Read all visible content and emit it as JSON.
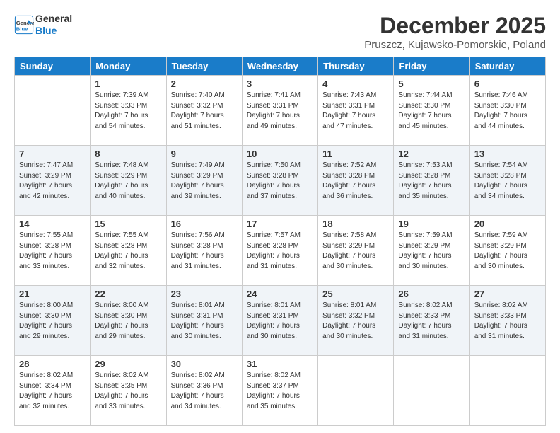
{
  "header": {
    "logo_line1": "General",
    "logo_line2": "Blue",
    "month": "December 2025",
    "location": "Pruszcz, Kujawsko-Pomorskie, Poland"
  },
  "days_of_week": [
    "Sunday",
    "Monday",
    "Tuesday",
    "Wednesday",
    "Thursday",
    "Friday",
    "Saturday"
  ],
  "weeks": [
    [
      {
        "day": "",
        "info": ""
      },
      {
        "day": "1",
        "info": "Sunrise: 7:39 AM\nSunset: 3:33 PM\nDaylight: 7 hours\nand 54 minutes."
      },
      {
        "day": "2",
        "info": "Sunrise: 7:40 AM\nSunset: 3:32 PM\nDaylight: 7 hours\nand 51 minutes."
      },
      {
        "day": "3",
        "info": "Sunrise: 7:41 AM\nSunset: 3:31 PM\nDaylight: 7 hours\nand 49 minutes."
      },
      {
        "day": "4",
        "info": "Sunrise: 7:43 AM\nSunset: 3:31 PM\nDaylight: 7 hours\nand 47 minutes."
      },
      {
        "day": "5",
        "info": "Sunrise: 7:44 AM\nSunset: 3:30 PM\nDaylight: 7 hours\nand 45 minutes."
      },
      {
        "day": "6",
        "info": "Sunrise: 7:46 AM\nSunset: 3:30 PM\nDaylight: 7 hours\nand 44 minutes."
      }
    ],
    [
      {
        "day": "7",
        "info": "Sunrise: 7:47 AM\nSunset: 3:29 PM\nDaylight: 7 hours\nand 42 minutes."
      },
      {
        "day": "8",
        "info": "Sunrise: 7:48 AM\nSunset: 3:29 PM\nDaylight: 7 hours\nand 40 minutes."
      },
      {
        "day": "9",
        "info": "Sunrise: 7:49 AM\nSunset: 3:29 PM\nDaylight: 7 hours\nand 39 minutes."
      },
      {
        "day": "10",
        "info": "Sunrise: 7:50 AM\nSunset: 3:28 PM\nDaylight: 7 hours\nand 37 minutes."
      },
      {
        "day": "11",
        "info": "Sunrise: 7:52 AM\nSunset: 3:28 PM\nDaylight: 7 hours\nand 36 minutes."
      },
      {
        "day": "12",
        "info": "Sunrise: 7:53 AM\nSunset: 3:28 PM\nDaylight: 7 hours\nand 35 minutes."
      },
      {
        "day": "13",
        "info": "Sunrise: 7:54 AM\nSunset: 3:28 PM\nDaylight: 7 hours\nand 34 minutes."
      }
    ],
    [
      {
        "day": "14",
        "info": "Sunrise: 7:55 AM\nSunset: 3:28 PM\nDaylight: 7 hours\nand 33 minutes."
      },
      {
        "day": "15",
        "info": "Sunrise: 7:55 AM\nSunset: 3:28 PM\nDaylight: 7 hours\nand 32 minutes."
      },
      {
        "day": "16",
        "info": "Sunrise: 7:56 AM\nSunset: 3:28 PM\nDaylight: 7 hours\nand 31 minutes."
      },
      {
        "day": "17",
        "info": "Sunrise: 7:57 AM\nSunset: 3:28 PM\nDaylight: 7 hours\nand 31 minutes."
      },
      {
        "day": "18",
        "info": "Sunrise: 7:58 AM\nSunset: 3:29 PM\nDaylight: 7 hours\nand 30 minutes."
      },
      {
        "day": "19",
        "info": "Sunrise: 7:59 AM\nSunset: 3:29 PM\nDaylight: 7 hours\nand 30 minutes."
      },
      {
        "day": "20",
        "info": "Sunrise: 7:59 AM\nSunset: 3:29 PM\nDaylight: 7 hours\nand 30 minutes."
      }
    ],
    [
      {
        "day": "21",
        "info": "Sunrise: 8:00 AM\nSunset: 3:30 PM\nDaylight: 7 hours\nand 29 minutes."
      },
      {
        "day": "22",
        "info": "Sunrise: 8:00 AM\nSunset: 3:30 PM\nDaylight: 7 hours\nand 29 minutes."
      },
      {
        "day": "23",
        "info": "Sunrise: 8:01 AM\nSunset: 3:31 PM\nDaylight: 7 hours\nand 30 minutes."
      },
      {
        "day": "24",
        "info": "Sunrise: 8:01 AM\nSunset: 3:31 PM\nDaylight: 7 hours\nand 30 minutes."
      },
      {
        "day": "25",
        "info": "Sunrise: 8:01 AM\nSunset: 3:32 PM\nDaylight: 7 hours\nand 30 minutes."
      },
      {
        "day": "26",
        "info": "Sunrise: 8:02 AM\nSunset: 3:33 PM\nDaylight: 7 hours\nand 31 minutes."
      },
      {
        "day": "27",
        "info": "Sunrise: 8:02 AM\nSunset: 3:33 PM\nDaylight: 7 hours\nand 31 minutes."
      }
    ],
    [
      {
        "day": "28",
        "info": "Sunrise: 8:02 AM\nSunset: 3:34 PM\nDaylight: 7 hours\nand 32 minutes."
      },
      {
        "day": "29",
        "info": "Sunrise: 8:02 AM\nSunset: 3:35 PM\nDaylight: 7 hours\nand 33 minutes."
      },
      {
        "day": "30",
        "info": "Sunrise: 8:02 AM\nSunset: 3:36 PM\nDaylight: 7 hours\nand 34 minutes."
      },
      {
        "day": "31",
        "info": "Sunrise: 8:02 AM\nSunset: 3:37 PM\nDaylight: 7 hours\nand 35 minutes."
      },
      {
        "day": "",
        "info": ""
      },
      {
        "day": "",
        "info": ""
      },
      {
        "day": "",
        "info": ""
      }
    ]
  ]
}
